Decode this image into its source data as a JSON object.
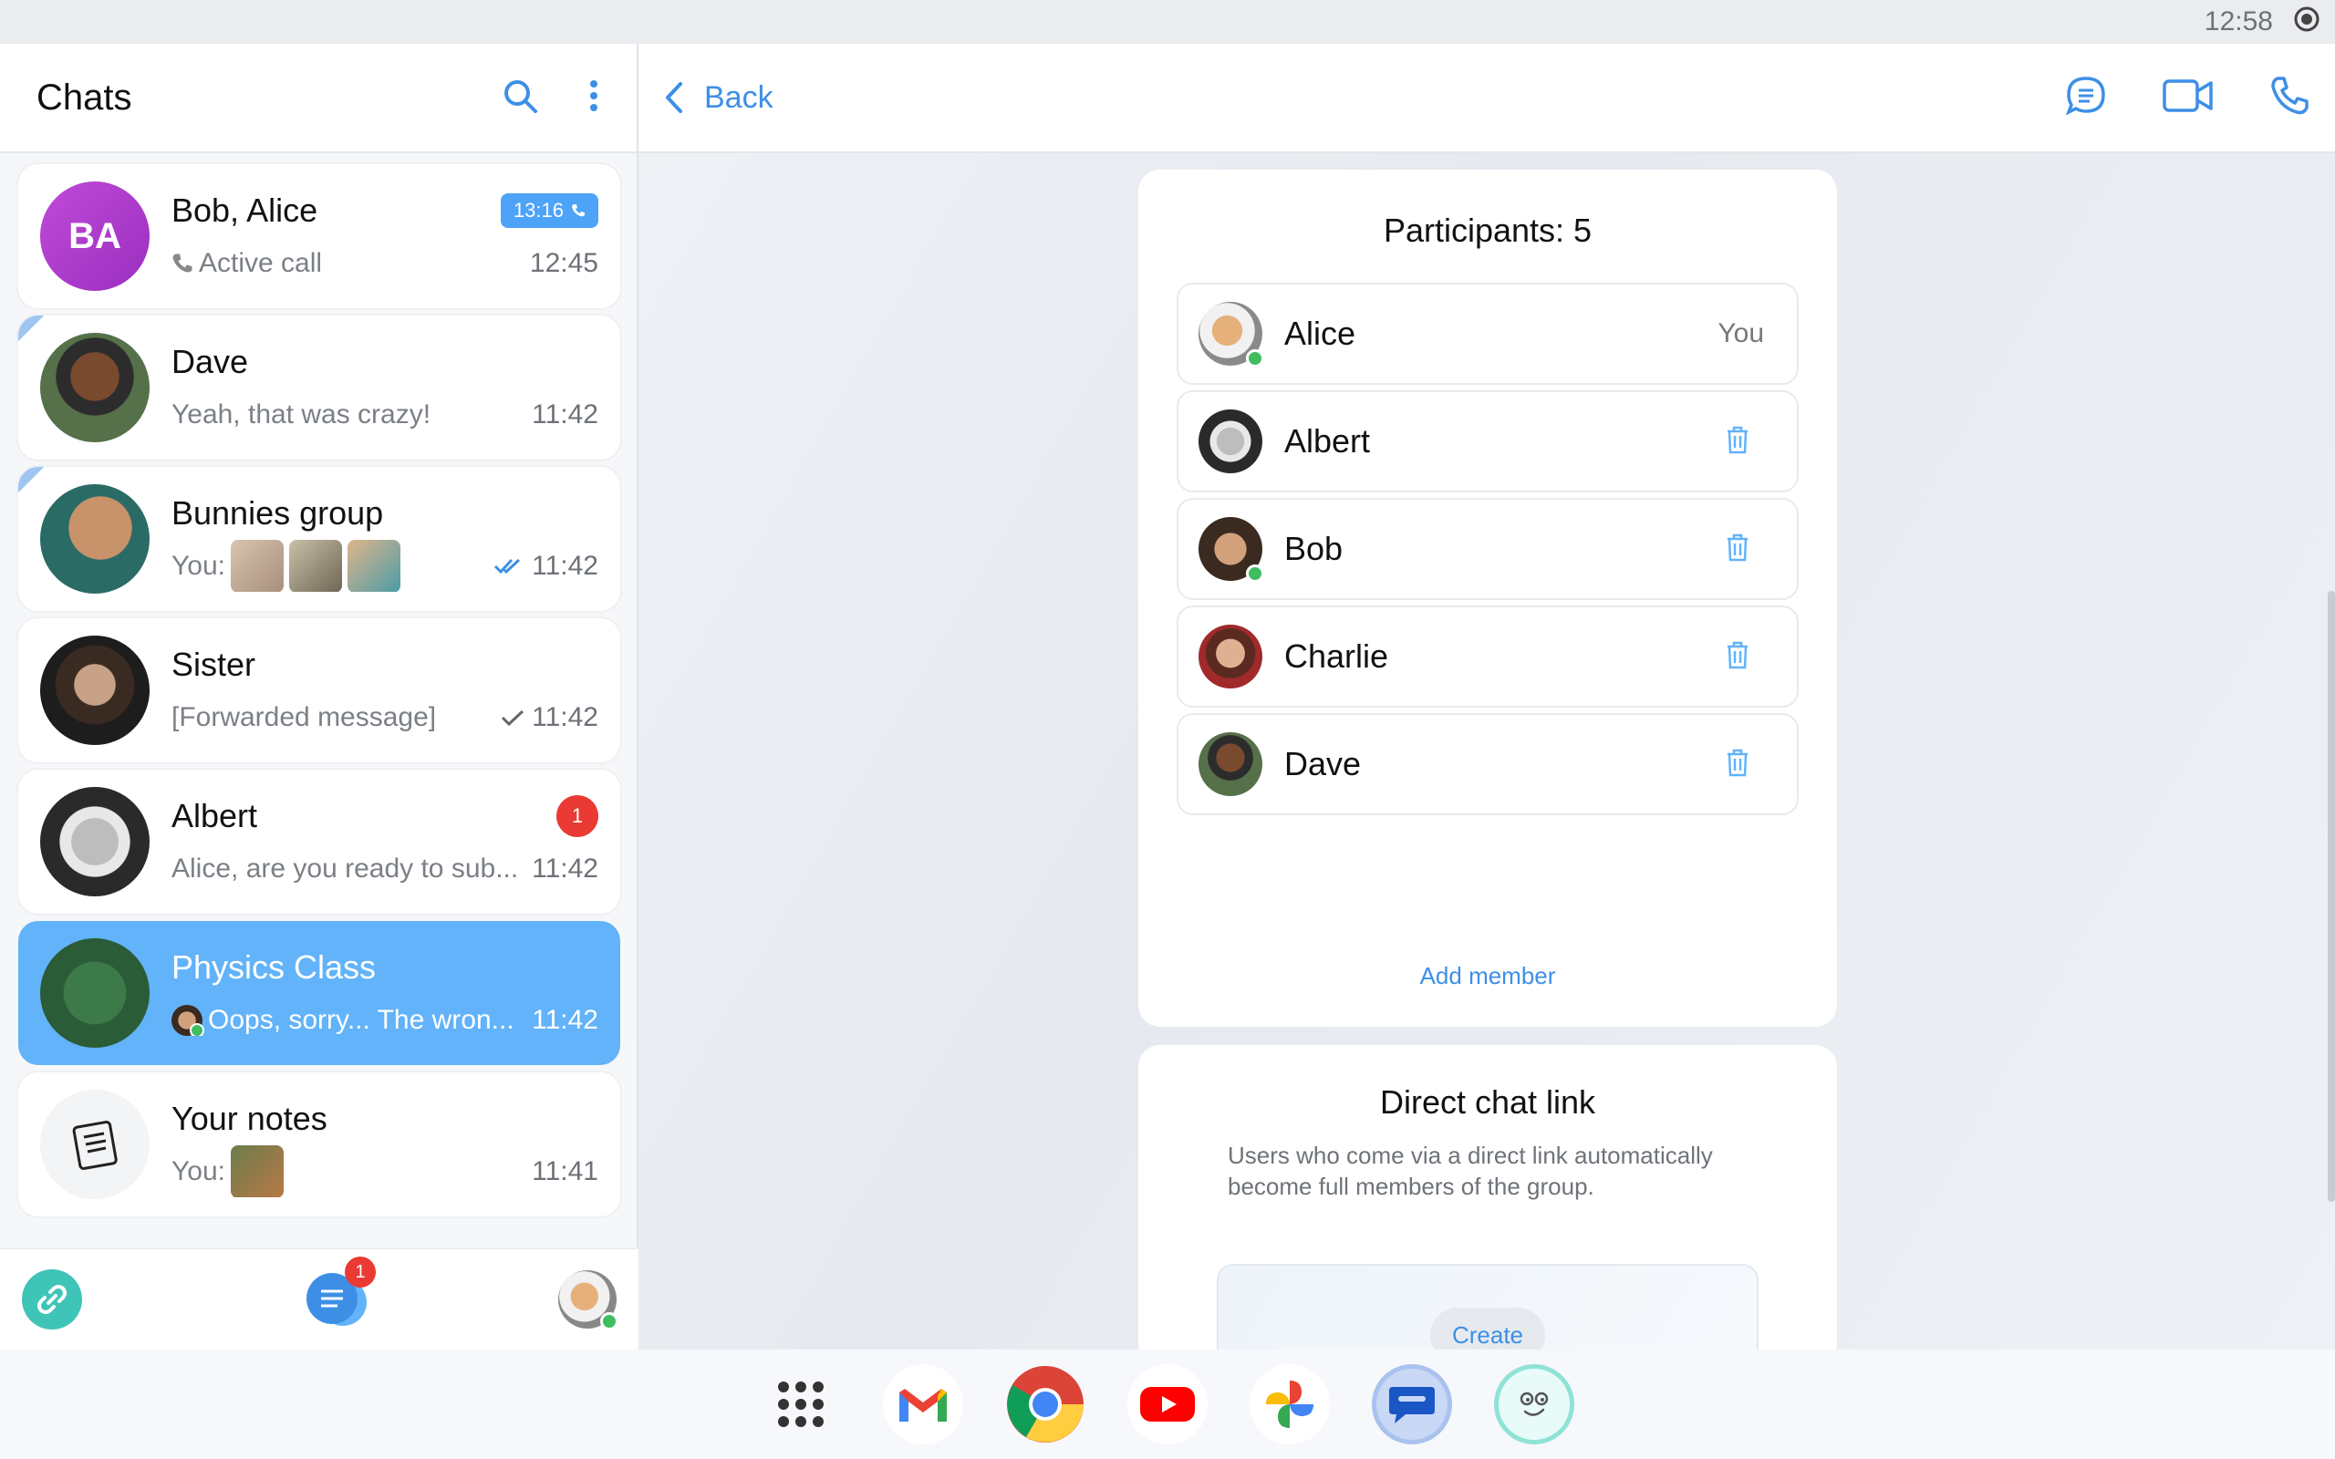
{
  "status": {
    "time": "12:58"
  },
  "left": {
    "title": "Chats",
    "chats": [
      {
        "name": "Bob, Alice",
        "avatar_text": "BA",
        "preview": "Active call",
        "call_badge": "13:16",
        "time": "12:45"
      },
      {
        "name": "Dave",
        "preview": "Yeah, that was crazy!",
        "time": "11:42"
      },
      {
        "name": "Bunnies group",
        "preview": "You:",
        "time": "11:42"
      },
      {
        "name": "Sister",
        "preview": "[Forwarded message]",
        "time": "11:42"
      },
      {
        "name": "Albert",
        "preview": "Alice, are you ready to sub...",
        "time": "11:42",
        "unread": "1"
      },
      {
        "name": "Physics Class",
        "preview": "Oops, sorry... The wron...",
        "time": "11:42"
      },
      {
        "name": "Your notes",
        "preview": "You:",
        "time": "11:41"
      }
    ],
    "bottom_badge": "1"
  },
  "right": {
    "back_label": "Back",
    "participants_title": "Participants: 5",
    "participants": [
      {
        "name": "Alice",
        "tag": "You"
      },
      {
        "name": "Albert"
      },
      {
        "name": "Bob"
      },
      {
        "name": "Charlie"
      },
      {
        "name": "Dave"
      }
    ],
    "add_member": "Add member",
    "direct_link_title": "Direct chat link",
    "direct_link_desc": "Users who come via a direct link automatically become full members of the group.",
    "create_label": "Create"
  },
  "colors": {
    "accent": "#3d8fe6",
    "selected": "#62b3f9",
    "unread": "#ea3a33",
    "online": "#3fbd5f"
  },
  "taskbar": [
    "apps-grid-icon",
    "gmail-icon",
    "chrome-icon",
    "youtube-icon",
    "photos-icon",
    "messages-icon",
    "face-app-icon"
  ]
}
